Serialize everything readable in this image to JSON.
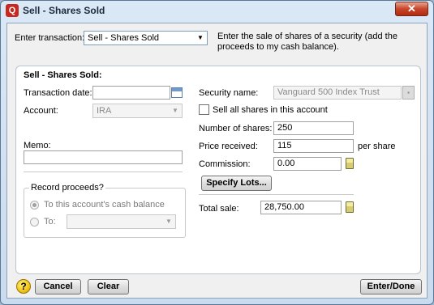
{
  "window": {
    "title": "Sell - Shares Sold",
    "close_glyph": "✕"
  },
  "header": {
    "enter_transaction_label": "Enter transaction:",
    "transaction_type": "Sell - Shares Sold",
    "description": "Enter the sale of shares of a security (add the proceeds to my cash balance)."
  },
  "panel": {
    "title": "Sell - Shares Sold:",
    "transaction_date_label": "Transaction date:",
    "transaction_date_value": "",
    "account_label": "Account:",
    "account_value": "IRA",
    "memo_label": "Memo:",
    "memo_value": "",
    "record_proceeds": {
      "title": "Record proceeds?",
      "option_cash": "To this account's cash balance",
      "option_to": "To:",
      "to_value": ""
    },
    "security_name_label": "Security name:",
    "security_name_value": "Vanguard 500 Index Trust",
    "sell_all_label": "Sell all shares in this account",
    "number_of_shares_label": "Number of shares:",
    "number_of_shares_value": "250",
    "price_received_label": "Price received:",
    "price_received_value": "115",
    "per_share_label": "per share",
    "commission_label": "Commission:",
    "commission_value": "0.00",
    "specify_lots_label": "Specify Lots...",
    "total_sale_label": "Total sale:",
    "total_sale_value": "28,750.00"
  },
  "footer": {
    "help_glyph": "?",
    "cancel_label": "Cancel",
    "clear_label": "Clear",
    "enter_done_label": "Enter/Done"
  },
  "colors": {
    "title_close_red": "#c7452a",
    "frame_blue": "#5a7896"
  }
}
